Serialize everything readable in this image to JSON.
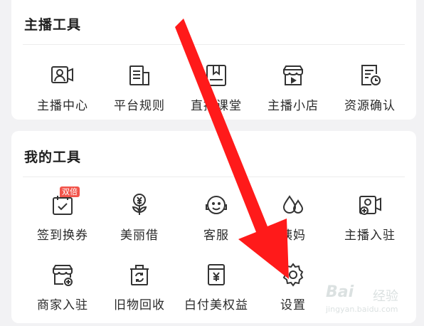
{
  "anchor_tools": {
    "title": "主播工具",
    "items": [
      {
        "label": "主播中心",
        "icon": "anchor-center-icon"
      },
      {
        "label": "平台规则",
        "icon": "platform-rules-icon"
      },
      {
        "label": "直播课堂",
        "icon": "live-classroom-icon"
      },
      {
        "label": "主播小店",
        "icon": "anchor-shop-icon"
      },
      {
        "label": "资源确认",
        "icon": "resource-confirm-icon"
      }
    ]
  },
  "my_tools": {
    "title": "我的工具",
    "items": [
      {
        "label": "签到换券",
        "icon": "checkin-calendar-icon",
        "badge": "双倍"
      },
      {
        "label": "美丽借",
        "icon": "yen-flower-icon"
      },
      {
        "label": "客服",
        "icon": "customer-service-icon"
      },
      {
        "label": "姨妈",
        "icon": "drops-icon"
      },
      {
        "label": "主播入驻",
        "icon": "anchor-join-icon"
      },
      {
        "label": "商家入驻",
        "icon": "merchant-join-icon"
      },
      {
        "label": "旧物回收",
        "icon": "recycle-icon"
      },
      {
        "label": "白付美权益",
        "icon": "yen-card-icon"
      },
      {
        "label": "设置",
        "icon": "settings-gear-icon"
      }
    ]
  },
  "watermark": {
    "brand": "Bai",
    "jingyan": "经验",
    "url": "jingyan.baidu.com"
  },
  "colors": {
    "arrow": "#ff1a1a",
    "badge": "#f2544b",
    "icon_stroke": "#333333"
  }
}
